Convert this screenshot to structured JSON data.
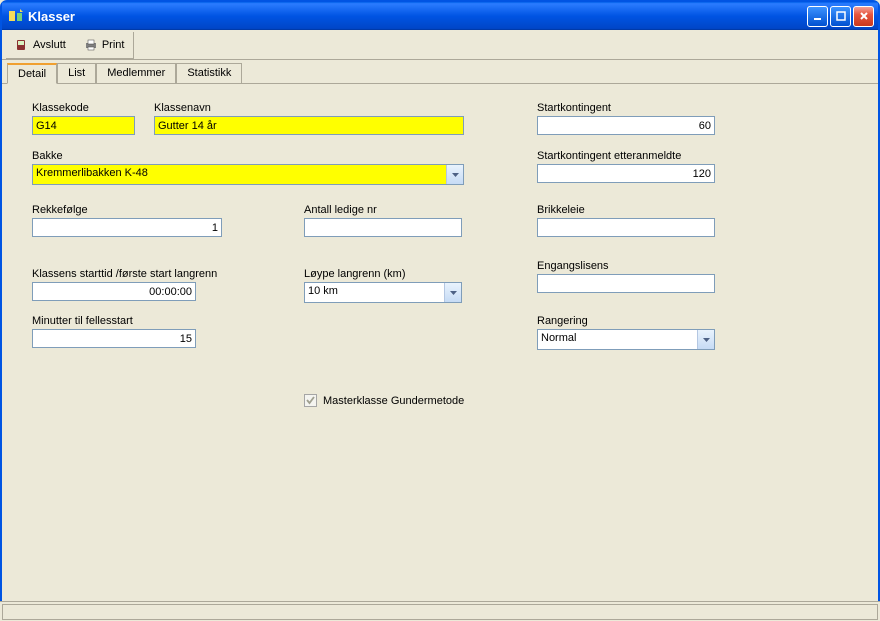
{
  "window": {
    "title": "Klasser"
  },
  "toolbar": {
    "avslutt": "Avslutt",
    "print": "Print"
  },
  "tabs": {
    "detail": "Detail",
    "list": "List",
    "medlemmer": "Medlemmer",
    "statistikk": "Statistikk"
  },
  "labels": {
    "klassekode": "Klassekode",
    "klassenavn": "Klassenavn",
    "bakke": "Bakke",
    "rekkefolge": "Rekkefølge",
    "antall_ledige": "Antall ledige nr",
    "klassens_starttid": "Klassens starttid /første start langrenn",
    "minutter_fellesstart": "Minutter til fellesstart",
    "loype_langrenn": "Løype langrenn (km)",
    "startkontingent": "Startkontingent",
    "startkontingent_etter": "Startkontingent etteranmeldte",
    "brikkeleie": "Brikkeleie",
    "engangslisens": "Engangslisens",
    "rangering": "Rangering",
    "masterklasse": "Masterklasse Gundermetode"
  },
  "values": {
    "klassekode": "G14",
    "klassenavn": "Gutter 14 år",
    "bakke": "Kremmerlibakken K-48",
    "rekkefolge": "1",
    "antall_ledige": "",
    "klassens_starttid": "00:00:00",
    "minutter_fellesstart": "15",
    "loype_langrenn": "10 km",
    "startkontingent": "60",
    "startkontingent_etter": "120",
    "brikkeleie": "",
    "engangslisens": "",
    "rangering": "Normal"
  }
}
